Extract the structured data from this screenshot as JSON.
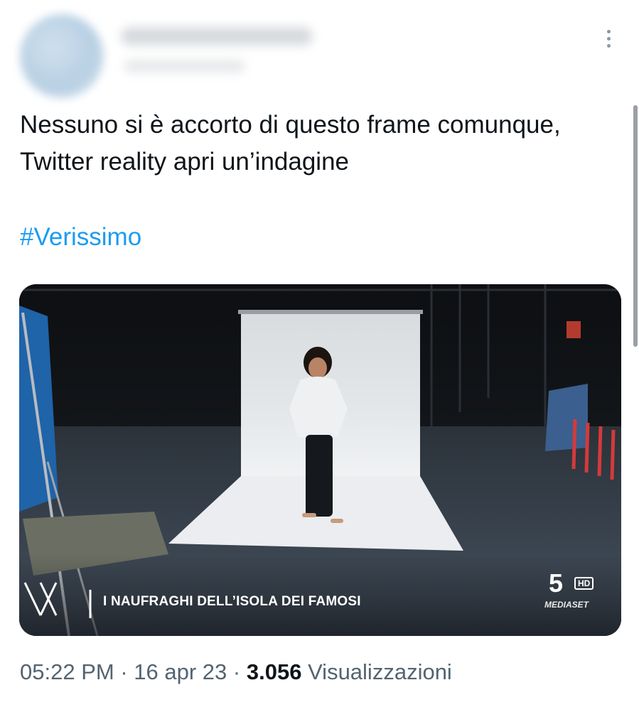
{
  "tweet": {
    "text": "Nessuno si è accorto di questo frame comunque, Twitter reality apri un’indagine",
    "hashtag": "#Verissimo"
  },
  "media": {
    "caption": "I NAUFRAGHI DELL’ISOLA DEI FAMOSI",
    "channel_number": "5",
    "channel_hd": "HD",
    "channel_brand": "MEDIASET"
  },
  "meta": {
    "time": "05:22 PM",
    "separator": "·",
    "date": "16 apr 23",
    "views_count": "3.056",
    "views_label": "Visualizzazioni"
  },
  "colors": {
    "link": "#1d9bf0",
    "secondary_text": "#536471",
    "primary_text": "#0f1419"
  }
}
